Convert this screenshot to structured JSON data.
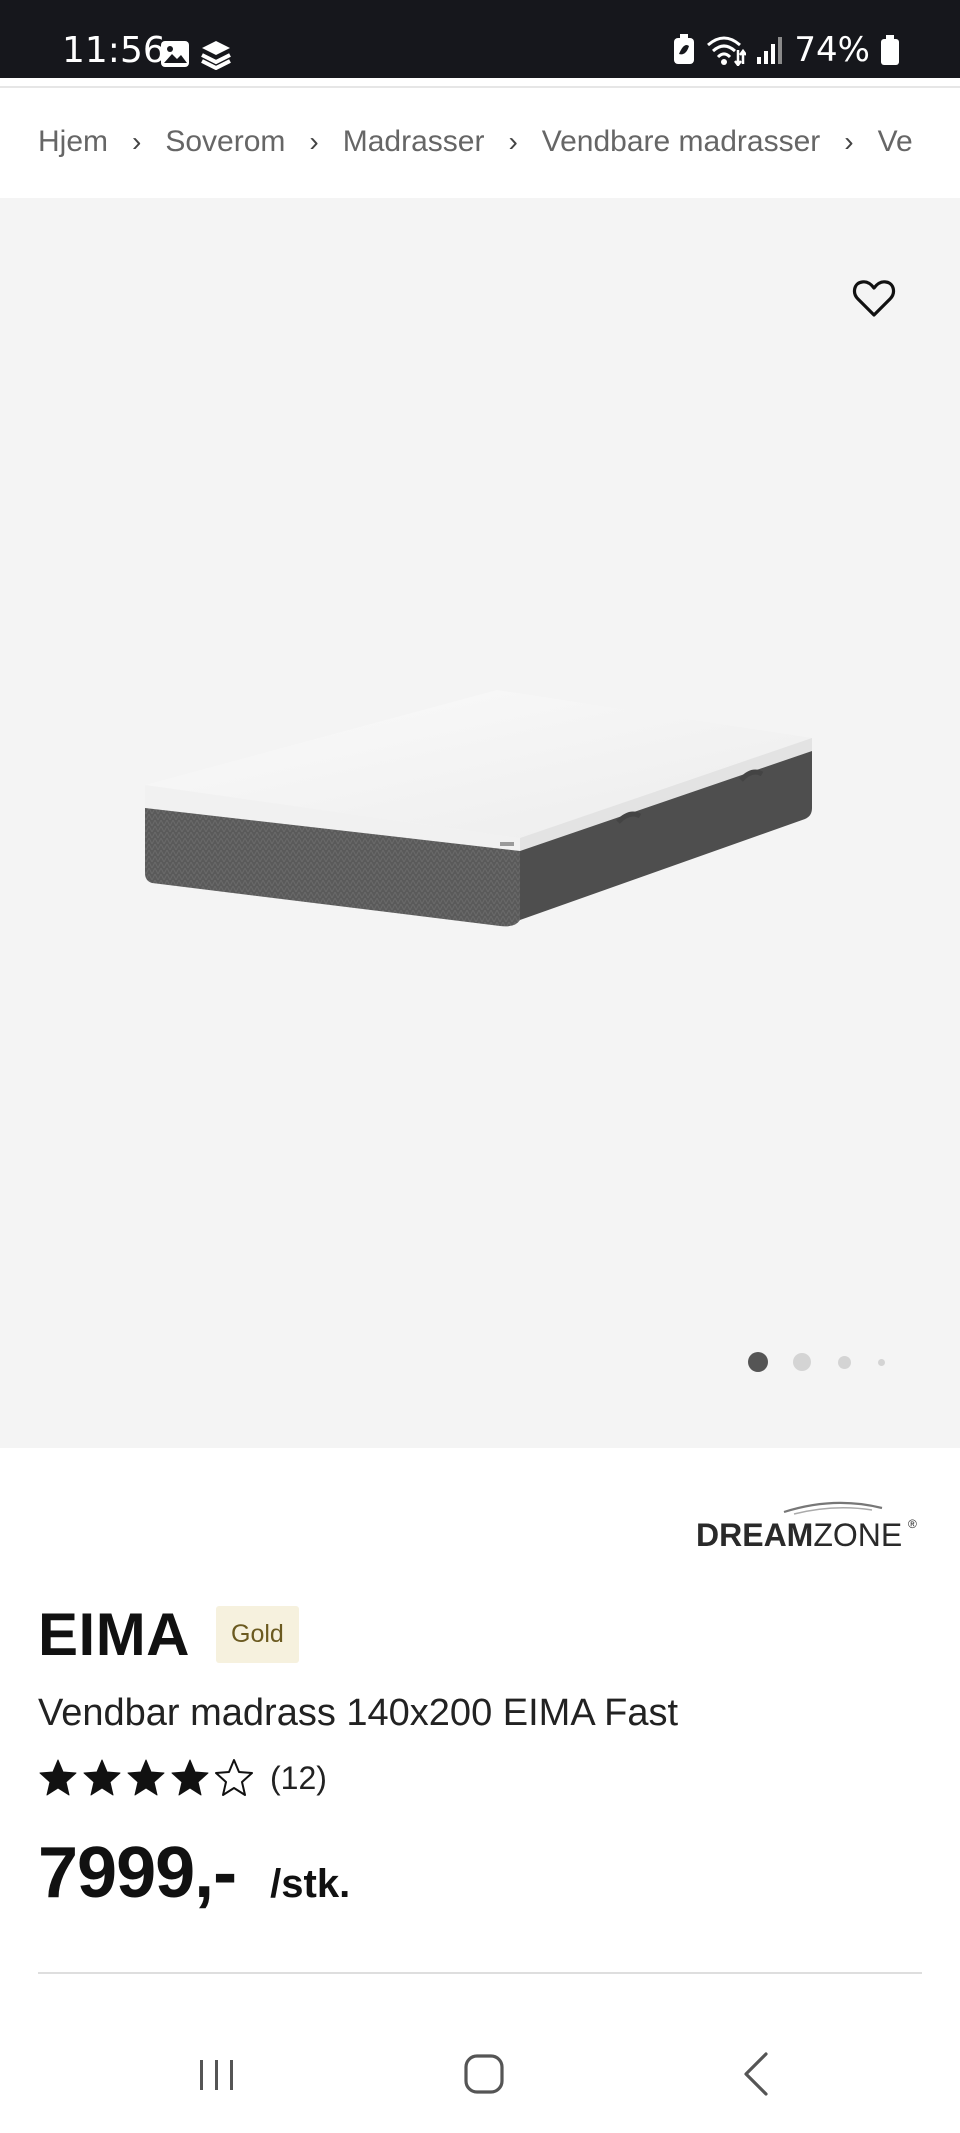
{
  "status_bar": {
    "time": "11:56",
    "battery_percent": "74%",
    "icons": [
      "gallery-icon",
      "app-icon",
      "battery-saver-icon",
      "wifi-icon",
      "signal-icon",
      "battery-icon"
    ]
  },
  "breadcrumb": {
    "items": [
      "Hjem",
      "Soverom",
      "Madrasser",
      "Vendbare madrasser",
      "Ve"
    ]
  },
  "gallery": {
    "wishlist_icon": "heart-icon",
    "page_count": 4,
    "active_index": 0
  },
  "product": {
    "brand_logo": {
      "word_bold": "DREAM",
      "word_light": "ZONE",
      "mark": "®"
    },
    "title": "EIMA",
    "badge": "Gold",
    "subtitle": "Vendbar madrass 140x200 EIMA Fast",
    "rating": {
      "stars": 4,
      "max": 5,
      "count_label": "(12)"
    },
    "price": "7999,-",
    "unit": "/stk."
  },
  "nav_bar": {
    "buttons": [
      "recent-apps-icon",
      "home-icon",
      "back-icon"
    ]
  },
  "colors": {
    "status_bar_bg": "#16171c",
    "gallery_bg": "#f4f4f4",
    "badge_bg": "#f6f1de",
    "badge_text": "#6b5a20"
  }
}
